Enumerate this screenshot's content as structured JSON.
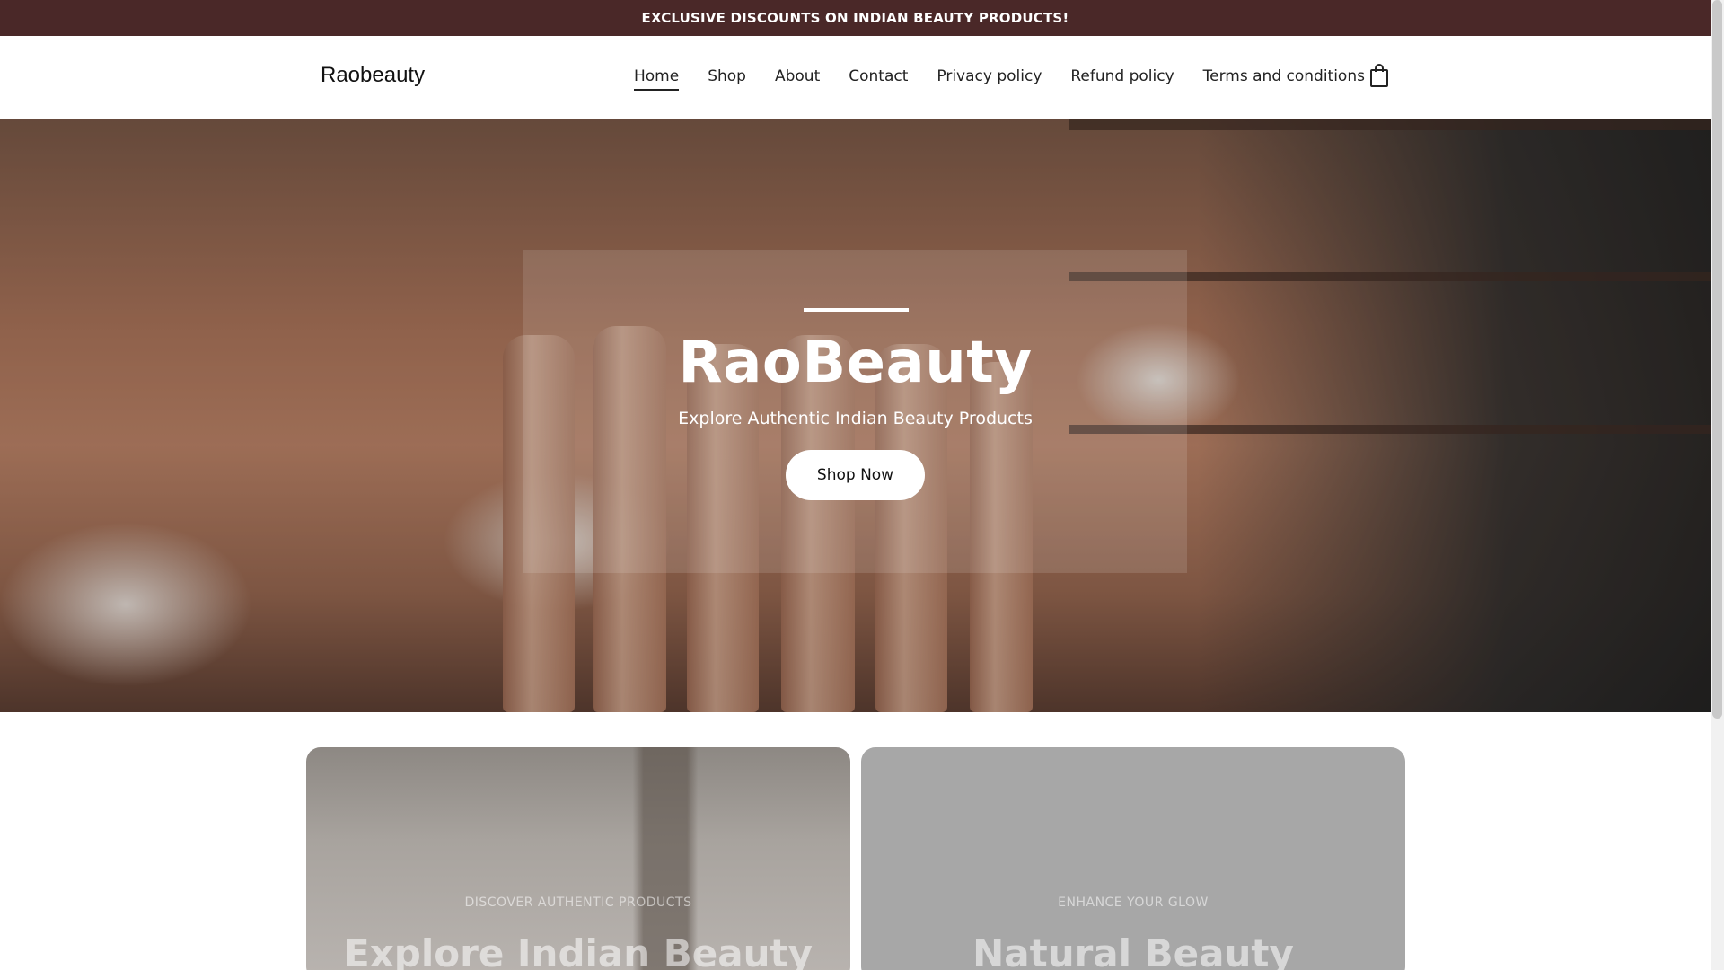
{
  "announcement": {
    "text": "EXCLUSIVE DISCOUNTS ON INDIAN BEAUTY PRODUCTS!"
  },
  "header": {
    "logo": "Raobeauty",
    "nav": [
      {
        "label": "Home",
        "active": true
      },
      {
        "label": "Shop"
      },
      {
        "label": "About"
      },
      {
        "label": "Contact"
      },
      {
        "label": "Privacy policy"
      },
      {
        "label": "Refund policy"
      },
      {
        "label": "Terms and conditions"
      }
    ],
    "cart_icon": "shopping-bag-icon"
  },
  "hero": {
    "title": "RaoBeauty",
    "subtitle": "Explore Authentic Indian Beauty Products",
    "cta": "Shop Now"
  },
  "promos": [
    {
      "eyebrow": "DISCOVER AUTHENTIC PRODUCTS",
      "heading": "Explore Indian Beauty"
    },
    {
      "eyebrow": "ENHANCE YOUR GLOW",
      "heading": "Natural Beauty"
    }
  ],
  "colors": {
    "announcement_bg": "#4a2828",
    "text": "#1e1e1e",
    "button_bg": "#ffffff"
  }
}
